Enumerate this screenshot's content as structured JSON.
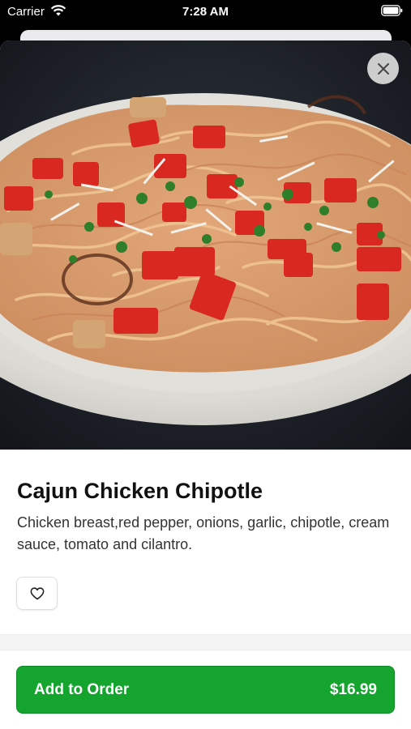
{
  "status_bar": {
    "carrier": "Carrier",
    "time": "7:28 AM"
  },
  "item": {
    "name": "Cajun Chicken Chipotle",
    "description": "Chicken breast,red pepper, onions, garlic, chipotle, cream sauce, tomato and cilantro.",
    "image_icon": "pasta-dish-photo"
  },
  "actions": {
    "close_icon": "close-icon",
    "favorite_icon": "heart-icon",
    "add_to_order_label": "Add to Order",
    "price": "$16.99"
  },
  "colors": {
    "accent": "#15a52f",
    "close_bg": "#dcdcdc"
  }
}
